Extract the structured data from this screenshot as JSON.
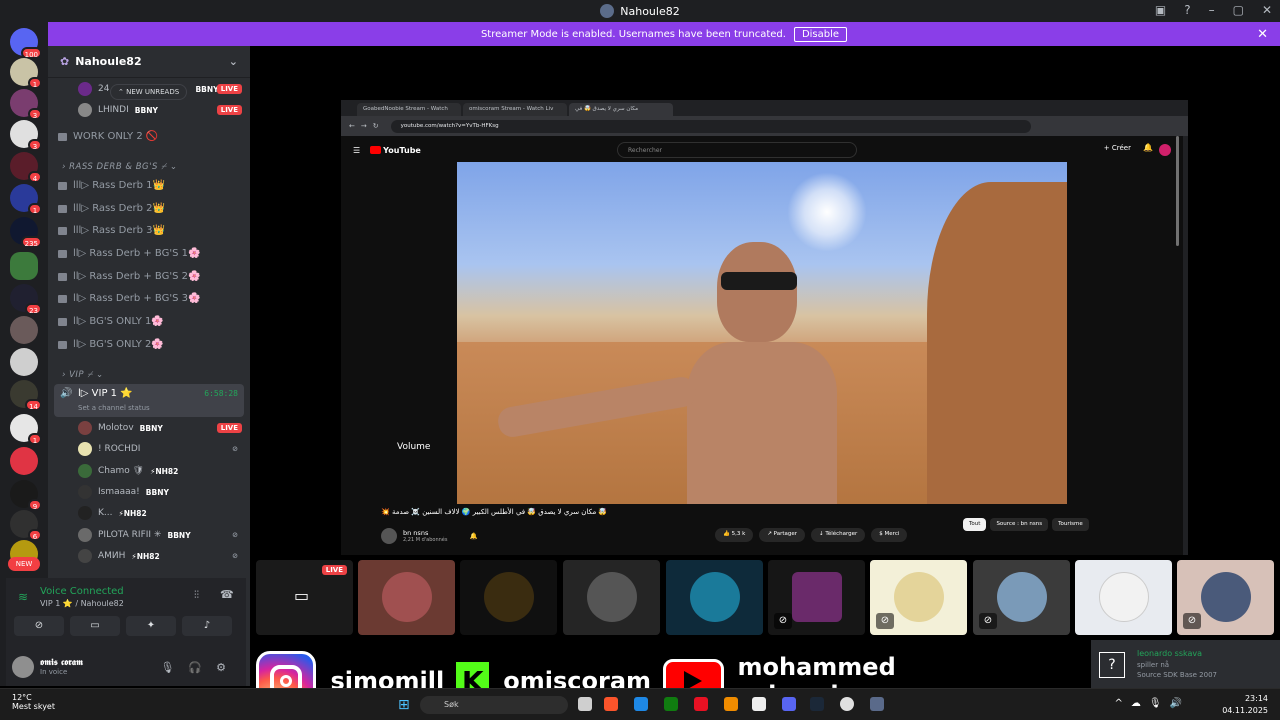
{
  "window": {
    "title": "Nahoule82"
  },
  "banner": {
    "text": "Streamer Mode is enabled. Usernames have been truncated.",
    "disable_label": "Disable"
  },
  "servers": [
    {
      "badge": "100"
    },
    {
      "badge": "1"
    },
    {
      "badge": "3"
    },
    {
      "badge": "3"
    },
    {
      "badge": "4"
    },
    {
      "badge": "1"
    },
    {
      "badge": "235"
    },
    {
      "badge": ""
    },
    {
      "badge": "23"
    },
    {
      "badge": ""
    },
    {
      "badge": ""
    },
    {
      "badge": "14"
    },
    {
      "badge": "1"
    },
    {
      "badge": ""
    },
    {
      "badge": "9"
    },
    {
      "badge": "6"
    },
    {
      "badge": ""
    }
  ],
  "new_pill": "NEW",
  "server_name": "Nahoule82",
  "new_unreads": "NEW UNREADS",
  "top_users": [
    {
      "name": "24",
      "tag": "BBNY",
      "live": "LIVE"
    },
    {
      "name": "LHINDI",
      "tag": "BBNY",
      "live": "LIVE"
    }
  ],
  "channels_top": [
    {
      "name": "WORK ONLY 2 🚫"
    }
  ],
  "category1": "RASS DERB & BG'S ⌿",
  "channels": [
    {
      "name": "lll▷ Rass Derb 1👑"
    },
    {
      "name": "lll▷ Rass Derb 2👑"
    },
    {
      "name": "lll▷ Rass Derb 3👑"
    },
    {
      "name": "ll▷ Rass Derb + BG'S 1🌸"
    },
    {
      "name": "ll▷ Rass Derb + BG'S 2🌸"
    },
    {
      "name": "ll▷ Rass Derb + BG'S 3🌸"
    },
    {
      "name": "ll▷ BG'S ONLY 1🌸"
    },
    {
      "name": "ll▷ BG'S ONLY 2🌸"
    }
  ],
  "category2": "VIP ⌿",
  "vip_channel": {
    "name": "l▷ VIP 1 ⭐",
    "timer": "6:58:28",
    "status": "Set a channel status"
  },
  "voice_users": [
    {
      "name": "Molotov",
      "tag": "BBNY",
      "live": "LIVE"
    },
    {
      "name": "! ROCHDI",
      "tag": "",
      "live": ""
    },
    {
      "name": "Chamo 🛡",
      "tag": "⚡NH82",
      "live": ""
    },
    {
      "name": "Ismaaaa!",
      "tag": "BBNY",
      "live": ""
    },
    {
      "name": "K...",
      "tag": "⚡NH82",
      "live": ""
    },
    {
      "name": "PILOTA RIFII ✳",
      "tag": "BBNY",
      "live": ""
    },
    {
      "name": "АМИН",
      "tag": "⚡NH82",
      "live": ""
    }
  ],
  "voice_panel": {
    "title": "Voice Connected",
    "subtitle": "VIP 1 ⭐ / Nahoule82"
  },
  "user": {
    "name": "𝖔𝖒𝖎𝖘 𝖈𝖔𝖗𝖆𝖒",
    "status": "In voice"
  },
  "browser": {
    "tabs": [
      "GoabedNoobie Stream - Watch",
      "omiscoram Stream - Watch Liv",
      "مكان سري لا يصدق 🤯 في"
    ],
    "url": "youtube.com/watch?v=YvTb-HFKsg",
    "search_placeholder": "Rechercher",
    "create_label": "Créer",
    "logo": "YouTube",
    "volume_label": "Volume",
    "video_title": "🤯 مكان سري لا يصدق 🤯 في الأطلس الكبير 🌍 لالاف السنين ☠️ صدمة 💥",
    "channel": "bn nsns",
    "subs": "2,21 M d'abonnés",
    "likes": "5,3 k",
    "share": "Partager",
    "download": "Télécharger",
    "thanks": "Merci",
    "chips": [
      "Tout",
      "Source : bn nsns",
      "Tourisme"
    ]
  },
  "tiles": [
    {
      "live": "LIVE",
      "color": "#1a1a1a"
    },
    {
      "live": "",
      "color": "#6b3a32"
    },
    {
      "live": "",
      "color": "#101010"
    },
    {
      "live": "",
      "color": "#252525"
    },
    {
      "live": "",
      "color": "#0e2a3a"
    },
    {
      "live": "",
      "color": "#161616"
    },
    {
      "live": "",
      "color": "#f3f0d8"
    },
    {
      "live": "",
      "color": "#3b3b3b"
    },
    {
      "live": "",
      "color": "#e8ebf0"
    },
    {
      "live": "",
      "color": "#d7c1b8"
    }
  ],
  "social": {
    "instagram": "simomill",
    "kick": "omiscoram",
    "youtube": "mohammed sebrani"
  },
  "toast": {
    "title": "leonardo sskava",
    "line1": "spiller nå",
    "line2": "Source SDK Base 2007"
  },
  "taskbar": {
    "temp": "12°C",
    "weather": "Mest skyet",
    "search": "Søk",
    "time": "23:14",
    "date": "04.11.2025"
  }
}
